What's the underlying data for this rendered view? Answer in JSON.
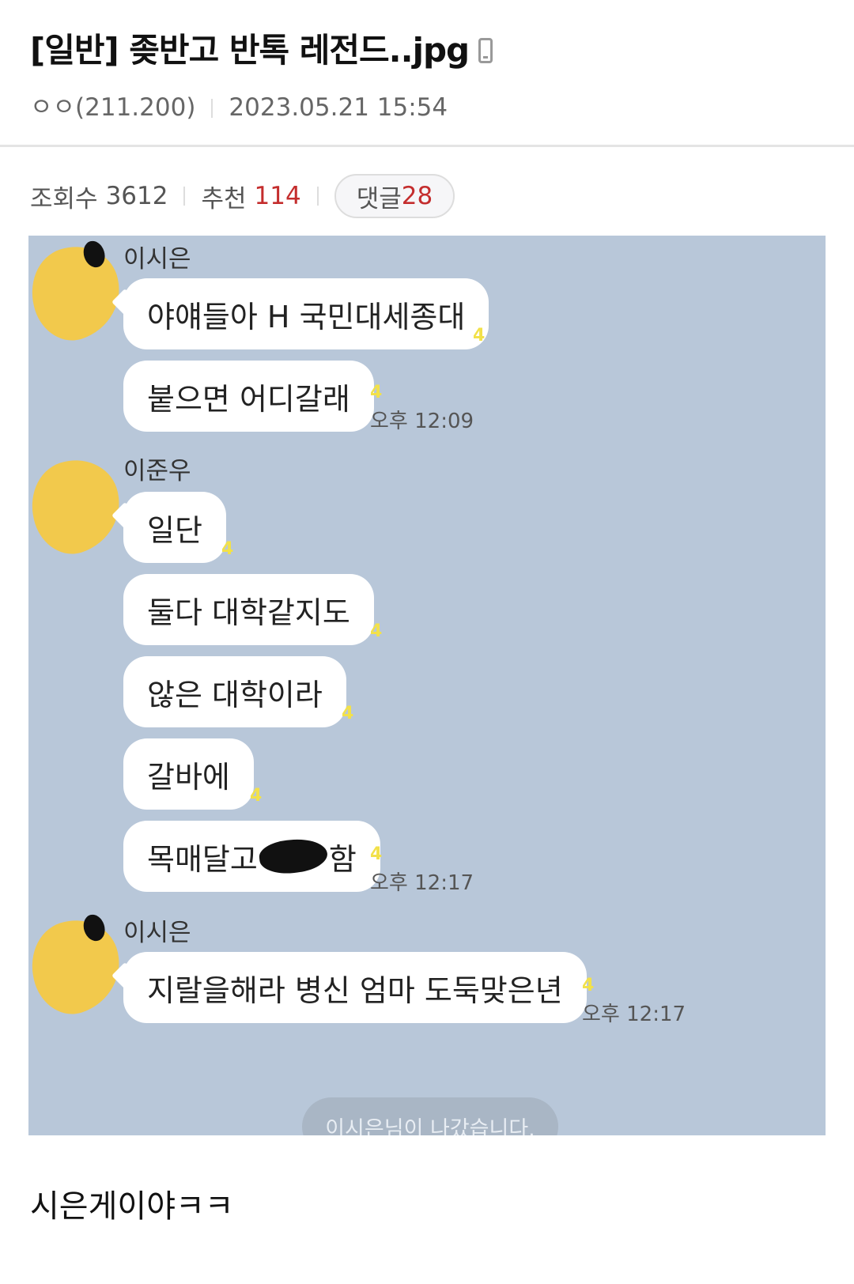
{
  "post": {
    "title": "[일반] 좆반고 반톡 레전드..jpg",
    "author": "ㅇㅇ(211.200)",
    "date": "2023.05.21 15:54",
    "views_label": "조회수",
    "views": "3612",
    "recommend_label": "추천",
    "recommend": "114",
    "comments_label": "댓글",
    "comments": "28",
    "body": "시은게이야ㅋㅋ"
  },
  "chat": {
    "groups": [
      {
        "sender": "이시은",
        "messages": [
          {
            "text": "야얘들아 H 국민대세종대",
            "unread": "4"
          },
          {
            "text": "붙으면 어디갈래",
            "unread": "4",
            "time": "오후 12:09"
          }
        ]
      },
      {
        "sender": "이준우",
        "messages": [
          {
            "text": "일단",
            "unread": "4"
          },
          {
            "text": "둘다 대학같지도",
            "unread": "4"
          },
          {
            "text": "않은 대학이라",
            "unread": "4"
          },
          {
            "text": "갈바에",
            "unread": "4"
          },
          {
            "text_before": "목매달고",
            "text_after": "함",
            "unread": "4",
            "time": "오후 12:17"
          }
        ]
      },
      {
        "sender": "이시은",
        "messages": [
          {
            "text": "지랄을해라 병신 엄마 도둑맞은년",
            "unread": "4",
            "time": "오후 12:17"
          }
        ]
      }
    ],
    "system_message": "이시은님이 나갔습니다."
  },
  "colors": {
    "chat_background": "#b8c7d9",
    "avatar": "#f2c94c",
    "unread_badge": "#f2e14a",
    "recommend_count": "#c42d2d",
    "comment_count": "#c42d2d"
  },
  "icons": [
    "mobile-phone-icon"
  ]
}
